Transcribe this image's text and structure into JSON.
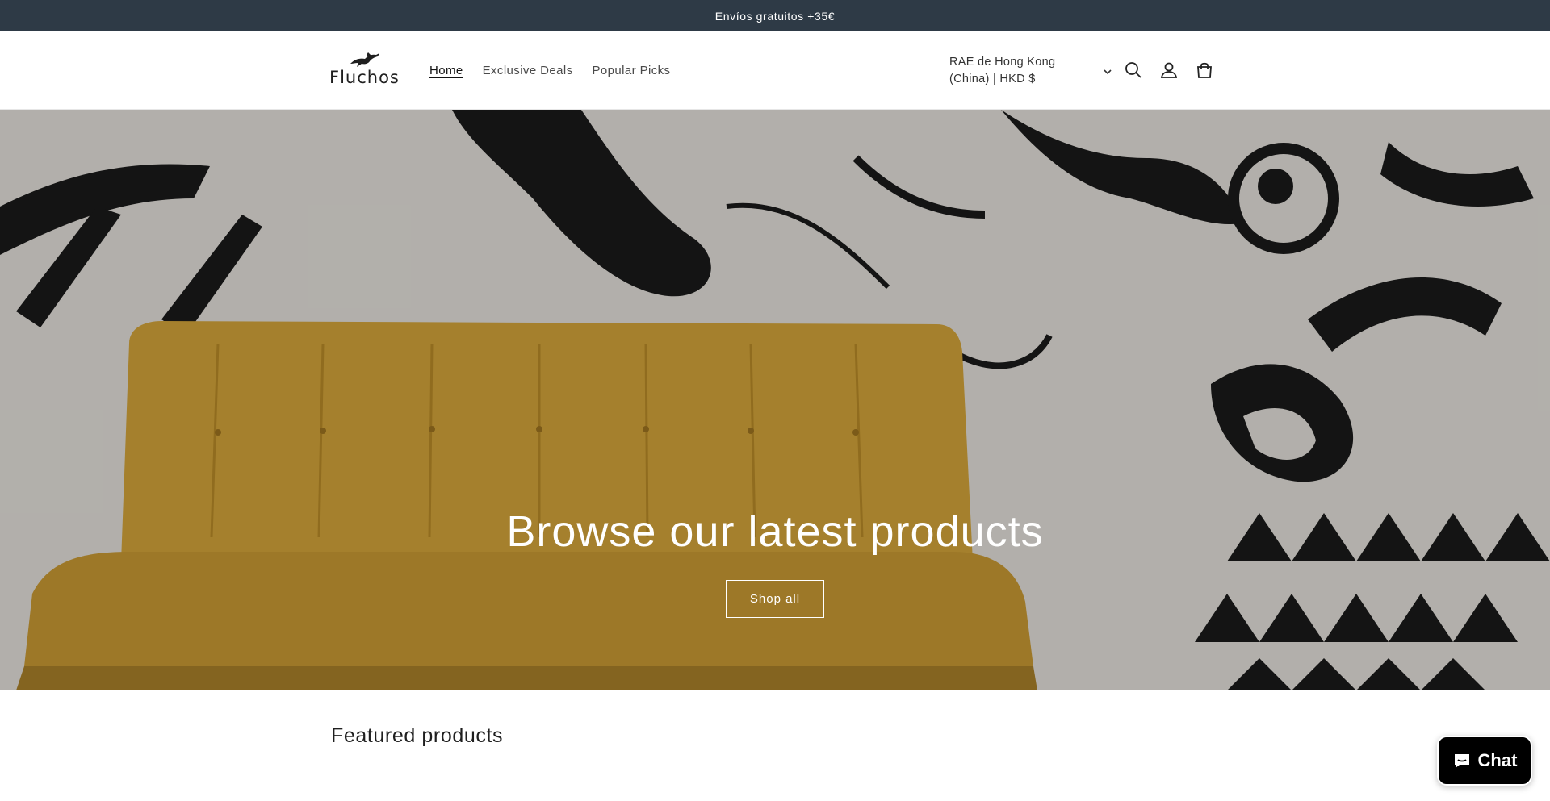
{
  "announcement": {
    "text": "Envíos gratuitos +35€"
  },
  "header": {
    "logo_text": "Fluchos",
    "nav": [
      {
        "label": "Home",
        "active": true
      },
      {
        "label": "Exclusive Deals",
        "active": false
      },
      {
        "label": "Popular Picks",
        "active": false
      }
    ],
    "locale_label": "RAE de Hong Kong (China) | HKD $",
    "icons": [
      "search-icon",
      "account-icon",
      "cart-icon",
      "chevron-down-icon"
    ]
  },
  "hero": {
    "heading": "Browse our latest products",
    "button_label": "Shop all"
  },
  "featured": {
    "title": "Featured products"
  },
  "chat": {
    "label": "Chat",
    "icon": "chat-bubble-icon",
    "color": "#000000"
  },
  "colors": {
    "announcement_bg": "#2e3a46",
    "sofa": "#d4a53a",
    "mural_ink": "#1a1a1a"
  }
}
